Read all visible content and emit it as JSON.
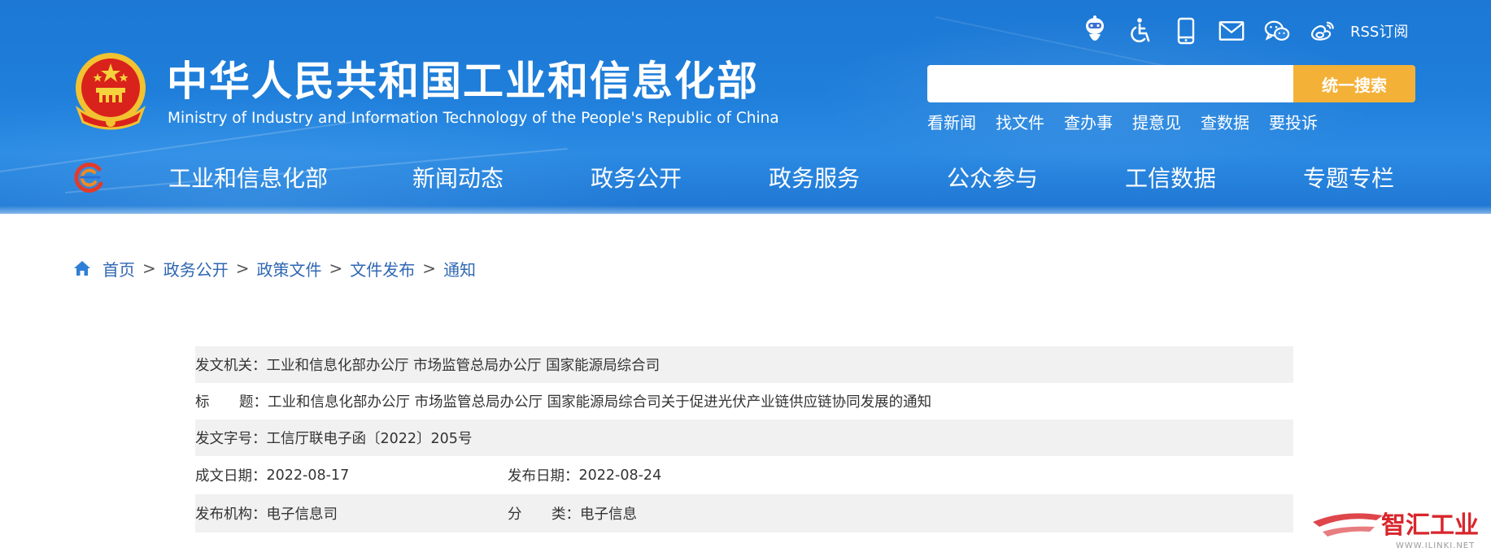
{
  "header": {
    "title_cn": "中华人民共和国工业和信息化部",
    "title_en": "Ministry of Industry and Information Technology of the People's Republic of China",
    "util_icons": [
      "robot-assistant-icon",
      "accessibility-icon",
      "mobile-icon",
      "mail-icon",
      "wechat-icon",
      "weibo-icon"
    ],
    "rss_label": "RSS订阅",
    "search": {
      "placeholder": "",
      "value": "",
      "button_label": "统一搜索"
    },
    "quick_links": [
      "看新闻",
      "找文件",
      "查办事",
      "提意见",
      "查数据",
      "要投诉"
    ],
    "nav": [
      "工业和信息化部",
      "新闻动态",
      "政务公开",
      "政务服务",
      "公众参与",
      "工信数据",
      "专题专栏"
    ]
  },
  "breadcrumb": [
    "首页",
    "政务公开",
    "政策文件",
    "文件发布",
    "通知"
  ],
  "breadcrumb_separator": ">",
  "info": {
    "issuer_label": "发文机关：",
    "issuer_value": "工业和信息化部办公厅 市场监管总局办公厅 国家能源局综合司",
    "title_label_a": "标",
    "title_label_b": "题：",
    "title_value": "工业和信息化部办公厅 市场监管总局办公厅 国家能源局综合司关于促进光伏产业链供应链协同发展的通知",
    "docno_label": "发文字号：",
    "docno_value": "工信厅联电子函〔2022〕205号",
    "written_label": "成文日期：",
    "written_value": "2022-08-17",
    "published_label": "发布日期：",
    "published_value": "2022-08-24",
    "org_label": "发布机构：",
    "org_value": "电子信息司",
    "category_label_a": "分",
    "category_label_b": "类：",
    "category_value": "电子信息"
  },
  "watermark": {
    "brand_cn": "智汇工业",
    "brand_url": "WWW.ILINKI.NET"
  },
  "colors": {
    "header_blue": "#1f7fdb",
    "search_button": "#f4b138",
    "breadcrumb_link": "#2f67b3",
    "row_shade": "#f1f1f1",
    "watermark_red": "#d8262c"
  }
}
